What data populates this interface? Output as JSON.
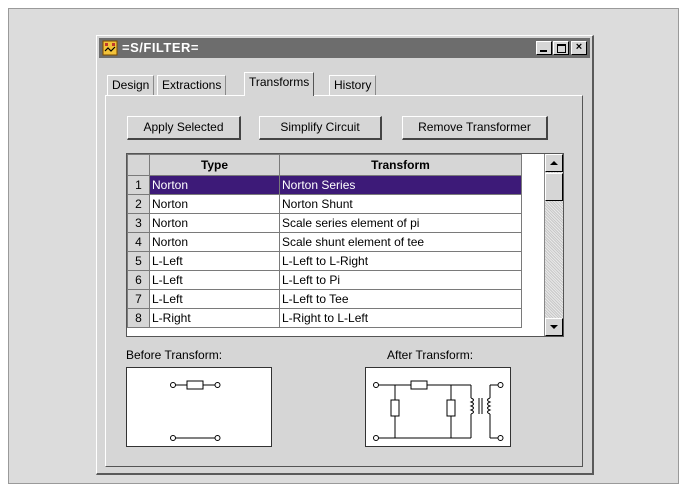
{
  "window": {
    "title": "=S/FILTER=",
    "icon": "app-filter-icon",
    "controls": {
      "minimize": "minimize-icon",
      "maximize": "maximize-icon",
      "close": "×"
    }
  },
  "tabs": [
    {
      "label": "Design",
      "active": false
    },
    {
      "label": "Extractions",
      "active": false
    },
    {
      "label": "Transforms",
      "active": true
    },
    {
      "label": "History",
      "active": false
    }
  ],
  "buttons": {
    "apply_selected": "Apply Selected",
    "simplify_circuit": "Simplify Circuit",
    "remove_transformer": "Remove Transformer"
  },
  "grid": {
    "columns": {
      "type": "Type",
      "transform": "Transform"
    },
    "selected_row": 1,
    "rows": [
      {
        "num": "1",
        "type": "Norton",
        "transform": "Norton Series"
      },
      {
        "num": "2",
        "type": "Norton",
        "transform": "Norton Shunt"
      },
      {
        "num": "3",
        "type": "Norton",
        "transform": "Scale series element of pi"
      },
      {
        "num": "4",
        "type": "Norton",
        "transform": "Scale shunt element of tee"
      },
      {
        "num": "5",
        "type": "L-Left",
        "transform": "L-Left to L-Right"
      },
      {
        "num": "6",
        "type": "L-Left",
        "transform": "L-Left to Pi"
      },
      {
        "num": "7",
        "type": "L-Left",
        "transform": "L-Left to Tee"
      },
      {
        "num": "8",
        "type": "L-Right",
        "transform": "L-Right to L-Left"
      }
    ]
  },
  "preview": {
    "before_label": "Before Transform:",
    "after_label": "After Transform:"
  },
  "colors": {
    "selection": "#3d1a78",
    "titlebar": "#6d6d6d",
    "face": "#d6d6d6"
  }
}
